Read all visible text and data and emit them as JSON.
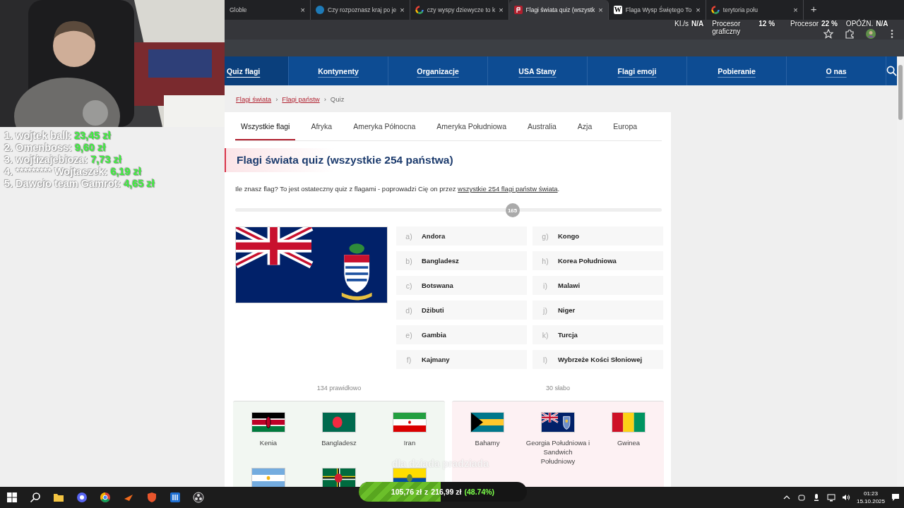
{
  "donations": [
    {
      "name": "1. wojtek ball:",
      "amount": "23,45 zł"
    },
    {
      "name": "2. Omenboss:",
      "amount": "9,60 zł"
    },
    {
      "name": "3. wojtizajebioza:",
      "amount": "7,73 zł"
    },
    {
      "name": "4. ********* Wojtaszek:",
      "amount": "6,19 zł"
    },
    {
      "name": "5. Dawcio team Gamrot:",
      "amount": "4,65 zł"
    }
  ],
  "browser": {
    "tabs": [
      {
        "kind": "plain",
        "title": "Globle",
        "close": "×",
        "selected": false
      },
      {
        "kind": "badge",
        "title": "Czy rozpoznasz kraj po je",
        "close": "×",
        "selected": false
      },
      {
        "kind": "google",
        "title": "czy wyspy dziewycze to k",
        "close": "×",
        "selected": false
      },
      {
        "kind": "flag",
        "title": "Flagi świata quiz (wszystk",
        "close": "×",
        "selected": true
      },
      {
        "kind": "wiki",
        "icon_text": "W",
        "title": "Flaga Wysp Świętego To",
        "close": "×",
        "selected": false
      },
      {
        "kind": "google",
        "title": "terytoria połu",
        "close": "×",
        "selected": false
      }
    ],
    "new_tab": "+"
  },
  "stream_stats": [
    {
      "label": "KI./s",
      "value": "N/A"
    },
    {
      "label": "Procesor graficzny",
      "value": "12 %"
    },
    {
      "label": "Procesor",
      "value": "22 %"
    },
    {
      "label": "OPÓŹN.",
      "value": "N/A"
    }
  ],
  "page": {
    "nav": [
      {
        "label": "Quiz flagi",
        "selected": true
      },
      {
        "label": "Kontynenty",
        "selected": false
      },
      {
        "label": "Organizacje",
        "selected": false
      },
      {
        "label": "USA Stany",
        "selected": false
      },
      {
        "label": "Flagi emoji",
        "selected": false
      },
      {
        "label": "Pobieranie",
        "selected": false
      },
      {
        "label": "O nas",
        "selected": false
      }
    ],
    "breadcrumb": {
      "separator": "›",
      "items": [
        {
          "label": "Flagi świata",
          "kind": "link"
        },
        {
          "label": "Flagi państw",
          "kind": "link"
        },
        {
          "label": "Quiz",
          "kind": "current"
        }
      ]
    },
    "categories": [
      {
        "label": "Wszystkie flagi",
        "selected": true
      },
      {
        "label": "Afryka",
        "selected": false
      },
      {
        "label": "Ameryka Północna",
        "selected": false
      },
      {
        "label": "Ameryka Południowa",
        "selected": false
      },
      {
        "label": "Australia",
        "selected": false
      },
      {
        "label": "Azja",
        "selected": false
      },
      {
        "label": "Europa",
        "selected": false
      }
    ],
    "title": "Flagi świata quiz (wszystkie 254 państwa)",
    "intro": {
      "text": "Ile znasz flag? To jest ostateczny quiz z flagami - poprowadzi Cię on przez ",
      "link": "wszystkie 254 flagi państw świata",
      "after": "."
    },
    "progress": {
      "label": "165",
      "level": 0.65
    },
    "question_flag": {
      "kind": "ky"
    },
    "options": [
      {
        "letter": "a)",
        "name": "Andora"
      },
      {
        "letter": "b)",
        "name": "Bangladesz"
      },
      {
        "letter": "c)",
        "name": "Botswana"
      },
      {
        "letter": "d)",
        "name": "Dżibuti"
      },
      {
        "letter": "e)",
        "name": "Gambia"
      },
      {
        "letter": "f)",
        "name": "Kajmany"
      },
      {
        "letter": "g)",
        "name": "Kongo"
      },
      {
        "letter": "h)",
        "name": "Korea Południowa"
      },
      {
        "letter": "i)",
        "name": "Malawi"
      },
      {
        "letter": "j)",
        "name": "Niger"
      },
      {
        "letter": "k)",
        "name": "Turcja"
      },
      {
        "letter": "l)",
        "name": "Wybrzeże Kości Słoniowej"
      }
    ],
    "results": [
      {
        "kind": "correct",
        "label": "134 prawidłowo",
        "flags": [
          {
            "kind": "ke",
            "name": "Kenia"
          },
          {
            "kind": "bd",
            "name": "Bangladesz"
          },
          {
            "kind": "ir",
            "name": "Iran"
          },
          {
            "kind": "ar"
          },
          {
            "kind": "dm"
          },
          {
            "kind": "ec"
          }
        ]
      },
      {
        "kind": "wrong",
        "label": "30 słabo",
        "flags": [
          {
            "kind": "bs",
            "name": "Bahamy"
          },
          {
            "kind": "gs",
            "name": "Georgia Południowa i Sandwich Południowy"
          },
          {
            "kind": "gn",
            "name": "Gwinea"
          }
        ]
      }
    ]
  },
  "goal": {
    "caption": "dla dziada pradziada",
    "raised": "105,76 zł",
    "separator": "z",
    "target": "216,99 zł",
    "percent": "(48.74%)",
    "level": 0.4874
  },
  "taskbar": {
    "apps": [
      {
        "kind": "start"
      },
      {
        "kind": "search"
      },
      {
        "kind": "folder"
      },
      {
        "kind": "chat"
      },
      {
        "kind": "browser"
      },
      {
        "kind": "arrow"
      },
      {
        "kind": "shield"
      },
      {
        "kind": "grid"
      },
      {
        "kind": "recorder"
      }
    ],
    "time": "01:23",
    "date": "15.10.2025"
  }
}
